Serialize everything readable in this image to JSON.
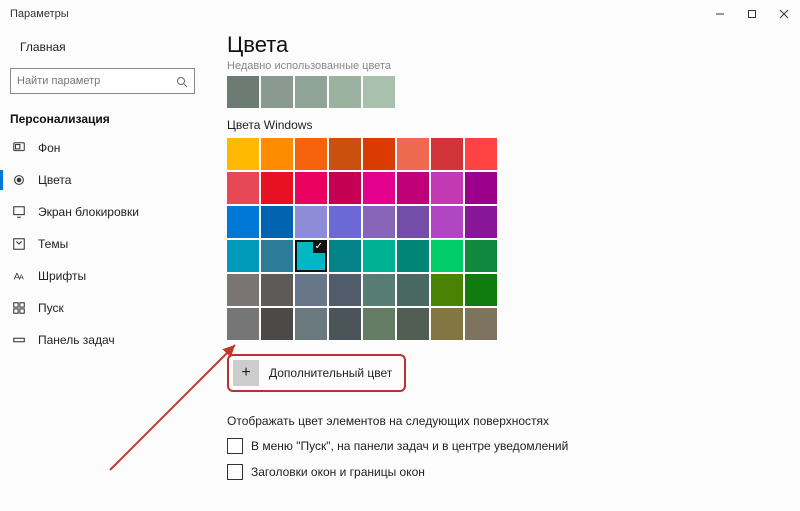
{
  "window": {
    "title": "Параметры"
  },
  "home": {
    "label": "Главная"
  },
  "search": {
    "placeholder": "Найти параметр"
  },
  "section": {
    "title": "Персонализация"
  },
  "nav": {
    "items": [
      {
        "label": "Фон"
      },
      {
        "label": "Цвета"
      },
      {
        "label": "Экран блокировки"
      },
      {
        "label": "Темы"
      },
      {
        "label": "Шрифты"
      },
      {
        "label": "Пуск"
      },
      {
        "label": "Панель задач"
      }
    ],
    "active_index": 1
  },
  "page": {
    "title": "Цвета",
    "recent_label": "Недавно использованные цвета",
    "recent_colors": [
      "#6c7b73",
      "#8a9a90",
      "#8fa396",
      "#9ab19f",
      "#a9c0ae"
    ],
    "windows_label": "Цвета Windows",
    "grid_colors": [
      "#ffb900",
      "#ff8c00",
      "#f7630c",
      "#ca5010",
      "#da3b01",
      "#ef6950",
      "#d13438",
      "#ff4343",
      "#e74856",
      "#e81123",
      "#ea005e",
      "#c30052",
      "#e3008c",
      "#bf0077",
      "#c239b3",
      "#9a0089",
      "#0078d7",
      "#0063b1",
      "#8e8cd8",
      "#6b69d6",
      "#8764b8",
      "#744da9",
      "#b146c2",
      "#881798",
      "#0099bc",
      "#2d7d9a",
      "#00b7c3",
      "#038387",
      "#00b294",
      "#018574",
      "#00cc6a",
      "#10893e",
      "#7a7574",
      "#5d5a58",
      "#68768a",
      "#515c6b",
      "#567c73",
      "#486860",
      "#498205",
      "#107c10",
      "#767676",
      "#4c4a48",
      "#69797e",
      "#4a5459",
      "#647c64",
      "#525e54",
      "#847545",
      "#7e735f"
    ],
    "selected_index": 26,
    "custom_button": "Дополнительный цвет",
    "surfaces_title": "Отображать цвет элементов на следующих поверхностях",
    "chk1": "В меню \"Пуск\", на панели задач и в центре уведомлений",
    "chk2": "Заголовки окон и границы окон"
  }
}
